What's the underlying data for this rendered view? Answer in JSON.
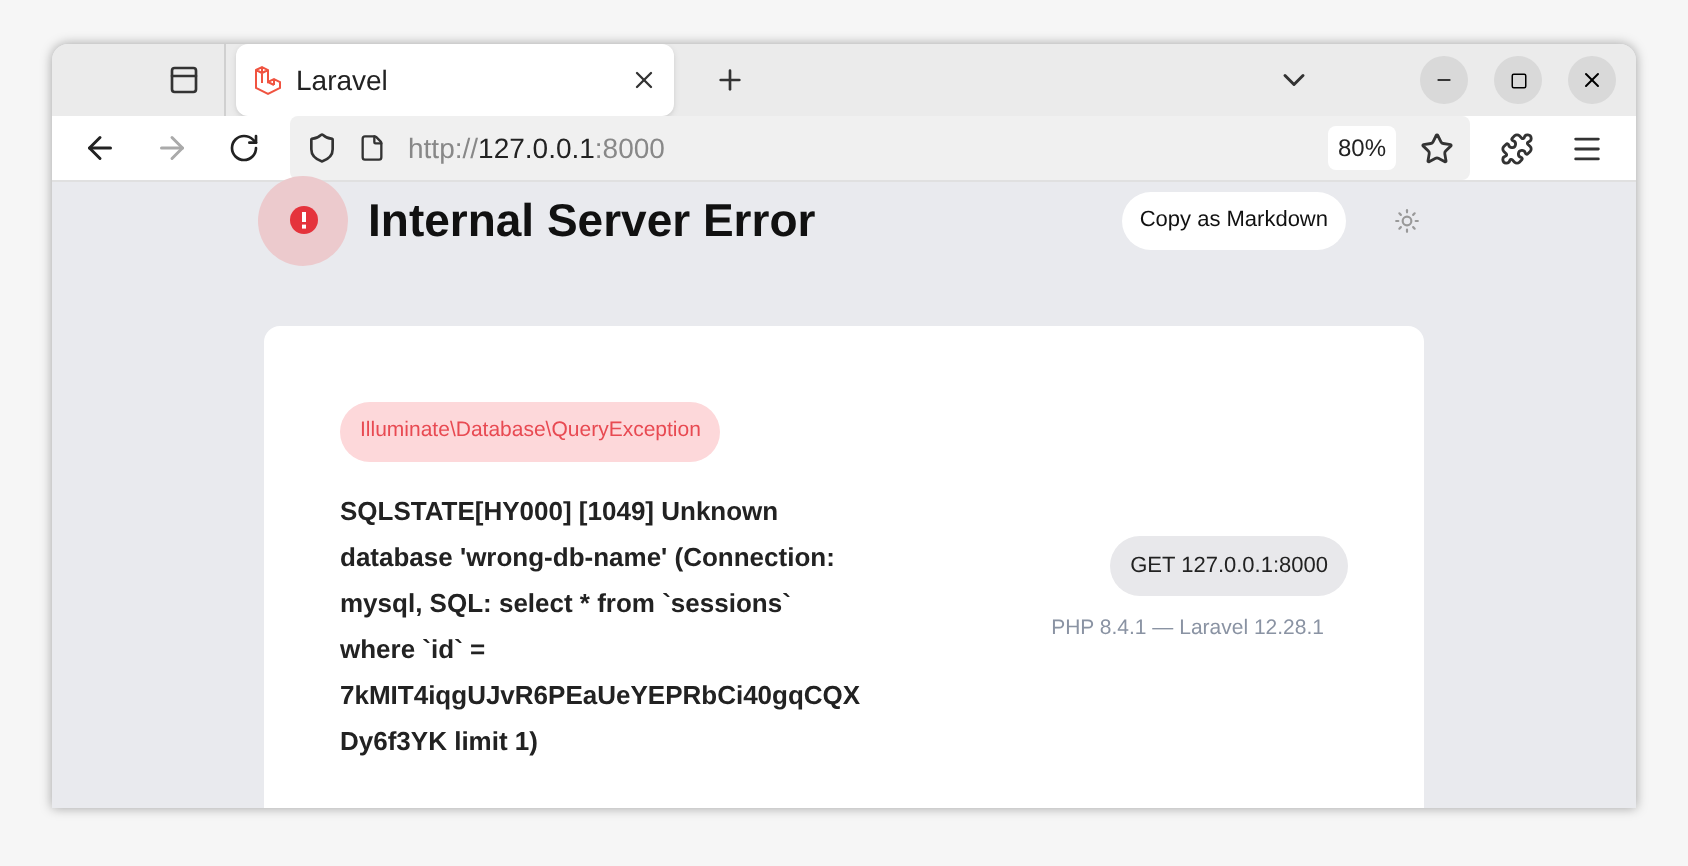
{
  "browser": {
    "tabs": [
      {
        "title": "Laravel",
        "selected": true
      }
    ],
    "url": {
      "scheme": "http://",
      "host": "127.0.0.1",
      "port": ":8000"
    },
    "zoom": "80%"
  },
  "page": {
    "title": "Internal Server Error",
    "copy_button": "Copy as Markdown",
    "exception": "Illuminate\\Database\\QueryException",
    "message": "SQLSTATE[HY000] [1049] Unknown database 'wrong-db-name' (Connection: mysql, SQL: select * from `sessions` where `id` = 7kMIT4iqgUJvR6PEaUeYEPRbCi40gqCQXDy6f3YK limit 1)",
    "request": "GET 127.0.0.1:8000",
    "versions": "PHP 8.4.1 — Laravel 12.28.1"
  }
}
